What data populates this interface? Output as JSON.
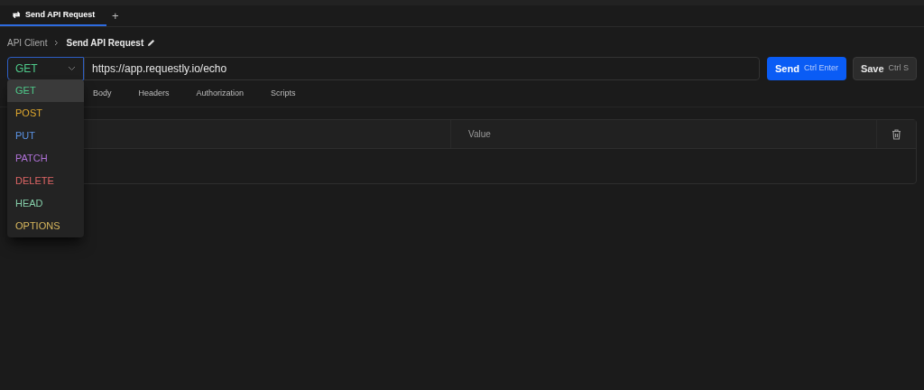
{
  "tabs": [
    {
      "icon": "⇄",
      "label": "Send API Request",
      "selected": true
    }
  ],
  "new_tab": "+",
  "breadcrumb": [
    "API Client",
    "Send API Request"
  ],
  "method": {
    "value": "GET",
    "color": "#4ec98a"
  },
  "url": "https://app.requestly.io/echo",
  "send_button": {
    "label": "Send",
    "shortcut": "Ctrl Enter"
  },
  "save_button": {
    "label": "Save",
    "shortcut": "Ctrl S"
  },
  "request_tabs": [
    "Body",
    "Headers",
    "Authorization",
    "Scripts"
  ],
  "table": {
    "columns": [
      "Value"
    ]
  },
  "method_menu": [
    {
      "label": "GET",
      "color": "#4ec98a",
      "selected": true
    },
    {
      "label": "POST",
      "color": "#e0a82e",
      "selected": false
    },
    {
      "label": "PUT",
      "color": "#5b94e6",
      "selected": false
    },
    {
      "label": "PATCH",
      "color": "#b072d8",
      "selected": false
    },
    {
      "label": "DELETE",
      "color": "#e06666",
      "selected": false
    },
    {
      "label": "HEAD",
      "color": "#86cfaa",
      "selected": false
    },
    {
      "label": "OPTIONS",
      "color": "#d9b85e",
      "selected": false
    }
  ]
}
